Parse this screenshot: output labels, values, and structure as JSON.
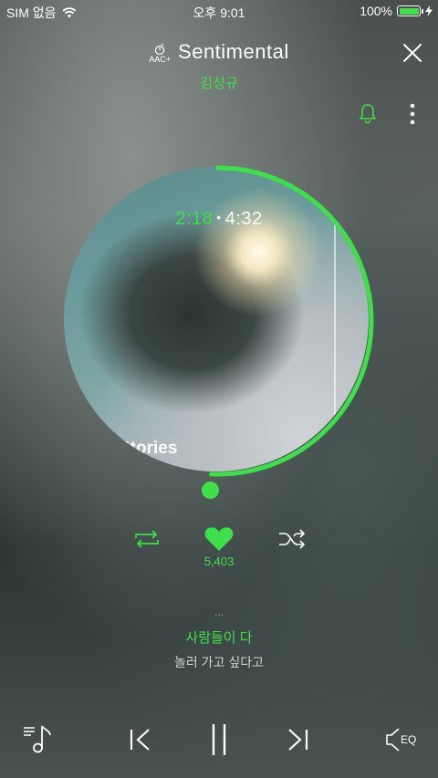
{
  "status_bar": {
    "carrier": "SIM 없음",
    "time": "오후 9:01",
    "battery_percent": "100%",
    "battery_level": 1.0,
    "icons": [
      "wifi-icon",
      "battery-icon",
      "charging-bolt-icon"
    ]
  },
  "header": {
    "codec_badge": "AAC+",
    "title": "Sentimental",
    "artist": "김성규",
    "icons": [
      "aac-plus-icon",
      "close-icon",
      "bell-icon",
      "more-vertical-icon"
    ]
  },
  "player": {
    "album_overlay_text": "Stories",
    "elapsed": "2:18",
    "duration": "4:32",
    "progress": 0.507,
    "like_count": "5,403",
    "liked": true,
    "repeat_active": true,
    "shuffle_active": false
  },
  "lyrics": {
    "previous_partial": "...",
    "current": "사람들이 다",
    "next": "놀러 가고 싶다고"
  },
  "bottom_controls": {
    "eq_label": "EQ",
    "icons": [
      "playlist-icon",
      "previous-track-icon",
      "pause-icon",
      "next-track-icon",
      "eq-icon"
    ]
  },
  "colors": {
    "accent": "#3ee04a",
    "text": "#ffffff"
  }
}
